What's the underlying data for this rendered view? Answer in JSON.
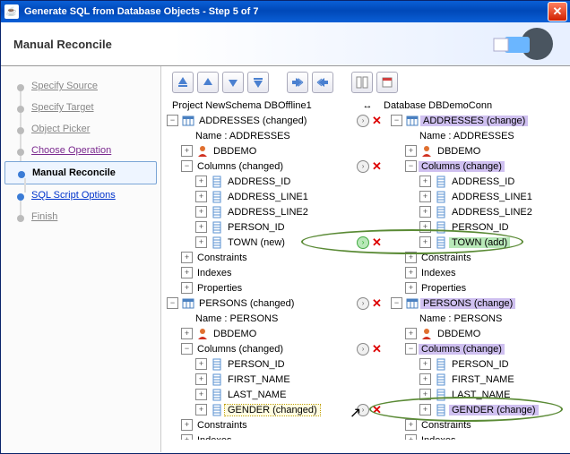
{
  "window": {
    "title": "Generate SQL from Database Objects - Step 5 of 7",
    "header": "Manual Reconcile"
  },
  "steps": [
    {
      "label": "Specify Source",
      "cls": "step-inactive"
    },
    {
      "label": "Specify Target",
      "cls": "step-inactive"
    },
    {
      "label": "Object Picker",
      "cls": "step-inactive"
    },
    {
      "label": "Choose Operation",
      "cls": "step-link"
    },
    {
      "label": "Manual Reconcile",
      "cls": "step-current"
    },
    {
      "label": "SQL Script Options",
      "cls": "step-blue-link"
    },
    {
      "label": "Finish",
      "cls": "step-inactive"
    }
  ],
  "cols": {
    "left_header": "Project NewSchema DBOffline1",
    "mid_header": "↔",
    "right_header": "Database DBDemoConn"
  },
  "left_tree": [
    {
      "ind": 0,
      "exp": "-",
      "ico": "table",
      "lbl": "ADDRESSES (changed)",
      "hl": "",
      "mid": [
        "arr",
        "x"
      ]
    },
    {
      "ind": 1,
      "exp": "",
      "ico": "",
      "lbl": "Name : ADDRESSES",
      "hl": "",
      "mid": []
    },
    {
      "ind": 1,
      "exp": "+",
      "ico": "user",
      "lbl": "DBDEMO",
      "hl": "",
      "mid": []
    },
    {
      "ind": 1,
      "exp": "-",
      "ico": "",
      "lbl": "Columns (changed)",
      "hl": "",
      "mid": [
        "arr",
        "x"
      ]
    },
    {
      "ind": 2,
      "exp": "+",
      "ico": "col",
      "lbl": "ADDRESS_ID",
      "hl": "",
      "mid": []
    },
    {
      "ind": 2,
      "exp": "+",
      "ico": "col",
      "lbl": "ADDRESS_LINE1",
      "hl": "",
      "mid": []
    },
    {
      "ind": 2,
      "exp": "+",
      "ico": "col",
      "lbl": "ADDRESS_LINE2",
      "hl": "",
      "mid": []
    },
    {
      "ind": 2,
      "exp": "+",
      "ico": "col",
      "lbl": "PERSON_ID",
      "hl": "",
      "mid": []
    },
    {
      "ind": 2,
      "exp": "+",
      "ico": "col",
      "lbl": "TOWN (new)",
      "hl": "",
      "mid": [
        "arrg",
        "x"
      ]
    },
    {
      "ind": 1,
      "exp": "+",
      "ico": "",
      "lbl": "Constraints",
      "hl": "",
      "mid": []
    },
    {
      "ind": 1,
      "exp": "+",
      "ico": "",
      "lbl": "Indexes",
      "hl": "",
      "mid": []
    },
    {
      "ind": 1,
      "exp": "+",
      "ico": "",
      "lbl": "Properties",
      "hl": "",
      "mid": []
    },
    {
      "ind": 0,
      "exp": "-",
      "ico": "table",
      "lbl": "PERSONS (changed)",
      "hl": "",
      "mid": [
        "arr",
        "x"
      ]
    },
    {
      "ind": 1,
      "exp": "",
      "ico": "",
      "lbl": "Name : PERSONS",
      "hl": "",
      "mid": []
    },
    {
      "ind": 1,
      "exp": "+",
      "ico": "user",
      "lbl": "DBDEMO",
      "hl": "",
      "mid": []
    },
    {
      "ind": 1,
      "exp": "-",
      "ico": "",
      "lbl": "Columns (changed)",
      "hl": "",
      "mid": [
        "arr",
        "x"
      ]
    },
    {
      "ind": 2,
      "exp": "+",
      "ico": "col",
      "lbl": "PERSON_ID",
      "hl": "",
      "mid": []
    },
    {
      "ind": 2,
      "exp": "+",
      "ico": "col",
      "lbl": "FIRST_NAME",
      "hl": "",
      "mid": []
    },
    {
      "ind": 2,
      "exp": "+",
      "ico": "col",
      "lbl": "LAST_NAME",
      "hl": "",
      "mid": []
    },
    {
      "ind": 2,
      "exp": "+",
      "ico": "col",
      "lbl": "GENDER (changed)",
      "hl": "hl-yellow",
      "mid": [
        "arr",
        "x"
      ]
    },
    {
      "ind": 1,
      "exp": "+",
      "ico": "",
      "lbl": "Constraints",
      "hl": "",
      "mid": []
    },
    {
      "ind": 1,
      "exp": "+",
      "ico": "",
      "lbl": "Indexes",
      "hl": "",
      "mid": []
    }
  ],
  "right_tree": [
    {
      "ind": 0,
      "exp": "-",
      "ico": "table",
      "lbl": "ADDRESSES (change)",
      "hl": "hl-purple"
    },
    {
      "ind": 1,
      "exp": "",
      "ico": "",
      "lbl": "Name : ADDRESSES",
      "hl": ""
    },
    {
      "ind": 1,
      "exp": "+",
      "ico": "user",
      "lbl": "DBDEMO",
      "hl": ""
    },
    {
      "ind": 1,
      "exp": "-",
      "ico": "",
      "lbl": "Columns (change)",
      "hl": "hl-purple"
    },
    {
      "ind": 2,
      "exp": "+",
      "ico": "col",
      "lbl": "ADDRESS_ID",
      "hl": ""
    },
    {
      "ind": 2,
      "exp": "+",
      "ico": "col",
      "lbl": "ADDRESS_LINE1",
      "hl": ""
    },
    {
      "ind": 2,
      "exp": "+",
      "ico": "col",
      "lbl": "ADDRESS_LINE2",
      "hl": ""
    },
    {
      "ind": 2,
      "exp": "+",
      "ico": "col",
      "lbl": "PERSON_ID",
      "hl": ""
    },
    {
      "ind": 2,
      "exp": "+",
      "ico": "col",
      "lbl": "TOWN (add)",
      "hl": "hl-green"
    },
    {
      "ind": 1,
      "exp": "+",
      "ico": "",
      "lbl": "Constraints",
      "hl": ""
    },
    {
      "ind": 1,
      "exp": "+",
      "ico": "",
      "lbl": "Indexes",
      "hl": ""
    },
    {
      "ind": 1,
      "exp": "+",
      "ico": "",
      "lbl": "Properties",
      "hl": ""
    },
    {
      "ind": 0,
      "exp": "-",
      "ico": "table",
      "lbl": "PERSONS (change)",
      "hl": "hl-purple"
    },
    {
      "ind": 1,
      "exp": "",
      "ico": "",
      "lbl": "Name : PERSONS",
      "hl": ""
    },
    {
      "ind": 1,
      "exp": "+",
      "ico": "user",
      "lbl": "DBDEMO",
      "hl": ""
    },
    {
      "ind": 1,
      "exp": "-",
      "ico": "",
      "lbl": "Columns (change)",
      "hl": "hl-purple"
    },
    {
      "ind": 2,
      "exp": "+",
      "ico": "col",
      "lbl": "PERSON_ID",
      "hl": ""
    },
    {
      "ind": 2,
      "exp": "+",
      "ico": "col",
      "lbl": "FIRST_NAME",
      "hl": ""
    },
    {
      "ind": 2,
      "exp": "+",
      "ico": "col",
      "lbl": "LAST_NAME",
      "hl": ""
    },
    {
      "ind": 2,
      "exp": "+",
      "ico": "col",
      "lbl": "GENDER (change)",
      "hl": "hl-purple"
    },
    {
      "ind": 1,
      "exp": "+",
      "ico": "",
      "lbl": "Constraints",
      "hl": ""
    },
    {
      "ind": 1,
      "exp": "+",
      "ico": "",
      "lbl": "Indexes",
      "hl": ""
    }
  ]
}
